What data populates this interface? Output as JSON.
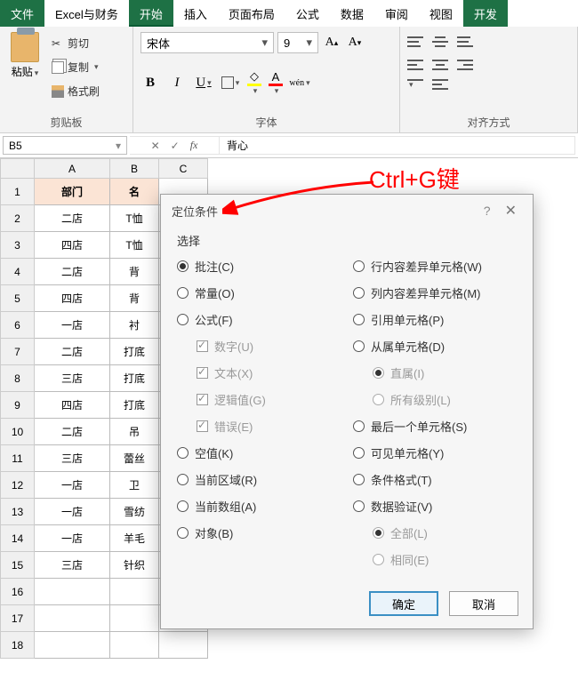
{
  "menu": {
    "tabs": [
      "文件",
      "Excel与财务",
      "开始",
      "插入",
      "页面布局",
      "公式",
      "数据",
      "审阅",
      "视图",
      "开发"
    ],
    "active": 2
  },
  "ribbon": {
    "clipboard": {
      "paste": "粘贴",
      "cut": "剪切",
      "copy": "复制",
      "format_painter": "格式刷",
      "title": "剪贴板"
    },
    "font": {
      "name": "宋体",
      "size": "9",
      "wen": "wén",
      "title": "字体"
    },
    "align": {
      "title": "对齐方式"
    }
  },
  "fx": {
    "cell_ref": "B5",
    "fx": "fx",
    "value": "背心"
  },
  "grid": {
    "cols": [
      "A",
      "B",
      "C"
    ],
    "header": [
      "部门",
      "名"
    ],
    "rows": [
      [
        "二店",
        "T恤"
      ],
      [
        "四店",
        "T恤"
      ],
      [
        "二店",
        "背"
      ],
      [
        "四店",
        "背"
      ],
      [
        "一店",
        "衬"
      ],
      [
        "二店",
        "打底"
      ],
      [
        "三店",
        "打底"
      ],
      [
        "四店",
        "打底"
      ],
      [
        "二店",
        "吊"
      ],
      [
        "三店",
        "蕾丝"
      ],
      [
        "一店",
        "卫"
      ],
      [
        "一店",
        "雪纺"
      ],
      [
        "一店",
        "羊毛"
      ],
      [
        "三店",
        "针织"
      ]
    ]
  },
  "dialog": {
    "title": "定位条件",
    "section": "选择",
    "left": [
      {
        "key": "comments",
        "label": "批注(C)",
        "selected": true
      },
      {
        "key": "constants",
        "label": "常量(O)"
      },
      {
        "key": "formulas",
        "label": "公式(F)",
        "sub": [
          {
            "key": "numbers",
            "label": "数字(U)",
            "checked": true
          },
          {
            "key": "text",
            "label": "文本(X)",
            "checked": true
          },
          {
            "key": "logical",
            "label": "逻辑值(G)",
            "checked": true
          },
          {
            "key": "errors",
            "label": "错误(E)",
            "checked": true
          }
        ]
      },
      {
        "key": "blanks",
        "label": "空值(K)"
      },
      {
        "key": "region",
        "label": "当前区域(R)"
      },
      {
        "key": "array",
        "label": "当前数组(A)"
      },
      {
        "key": "objects",
        "label": "对象(B)"
      }
    ],
    "right": [
      {
        "key": "rowdiff",
        "label": "行内容差异单元格(W)"
      },
      {
        "key": "coldiff",
        "label": "列内容差异单元格(M)"
      },
      {
        "key": "precedents",
        "label": "引用单元格(P)"
      },
      {
        "key": "dependents",
        "label": "从属单元格(D)",
        "sub_radio": [
          {
            "key": "direct",
            "label": "直属(I)",
            "selected": true
          },
          {
            "key": "all",
            "label": "所有级别(L)"
          }
        ]
      },
      {
        "key": "last",
        "label": "最后一个单元格(S)"
      },
      {
        "key": "visible",
        "label": "可见单元格(Y)"
      },
      {
        "key": "condfmt",
        "label": "条件格式(T)"
      },
      {
        "key": "datavalid",
        "label": "数据验证(V)",
        "sub_radio": [
          {
            "key": "all2",
            "label": "全部(L)",
            "selected": true
          },
          {
            "key": "same",
            "label": "相同(E)"
          }
        ]
      }
    ],
    "ok": "确定",
    "cancel": "取消"
  },
  "annotation": "Ctrl+G键"
}
